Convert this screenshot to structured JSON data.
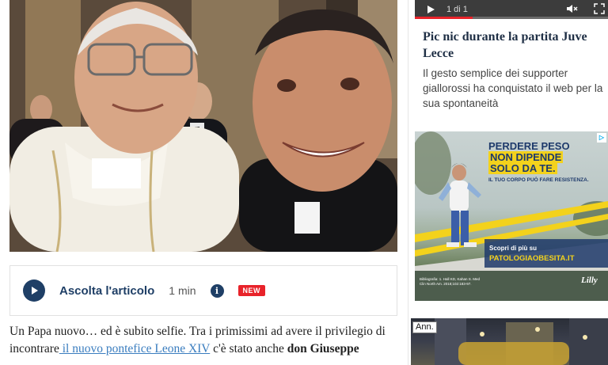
{
  "hero": {
    "alt": "Selfie con il nuovo pontefice"
  },
  "audio": {
    "label": "Ascolta l'articolo",
    "duration": "1 min",
    "info_icon": "i",
    "badge": "NEW"
  },
  "article": {
    "p1_a": "Un Papa nuovo… ed è subito selfie. Tra i primissimi ad avere il privilegio di incontrare",
    "p1_link": " il nuovo pontefice Leone XIV",
    "p1_b": " c'è stato anche ",
    "p1_bold": "don Giuseppe"
  },
  "sidebar": {
    "video_time": "1 di 1",
    "video_progress": 0.3,
    "title": "Pic nic durante la partita Juve Lecce",
    "desc": "Il gesto semplice dei supporter giallorossi ha conquistato il web per la sua spontaneità"
  },
  "ad": {
    "headline_1": "PERDERE PESO",
    "headline_2": "NON DIPENDE",
    "headline_3": "SOLO DA TE.",
    "sub": "IL TUO CORPO PUÒ FARE RESISTENZA.",
    "cta": "Scopri di più su",
    "url": "PATOLOGIAOBESITA.IT",
    "brand": "Lilly",
    "fine_print": "Bibliografia: 1. Hall KD, Kahan S. Med Clin North Am. 2018;102:183-97.",
    "choices_icon": "▷"
  },
  "ann": {
    "tag": "Ann."
  },
  "colors": {
    "brand_blue": "#1f3f66",
    "link_blue": "#3a7dbf",
    "badge_red": "#e8232a",
    "ad_yellow": "#f3d21c"
  }
}
